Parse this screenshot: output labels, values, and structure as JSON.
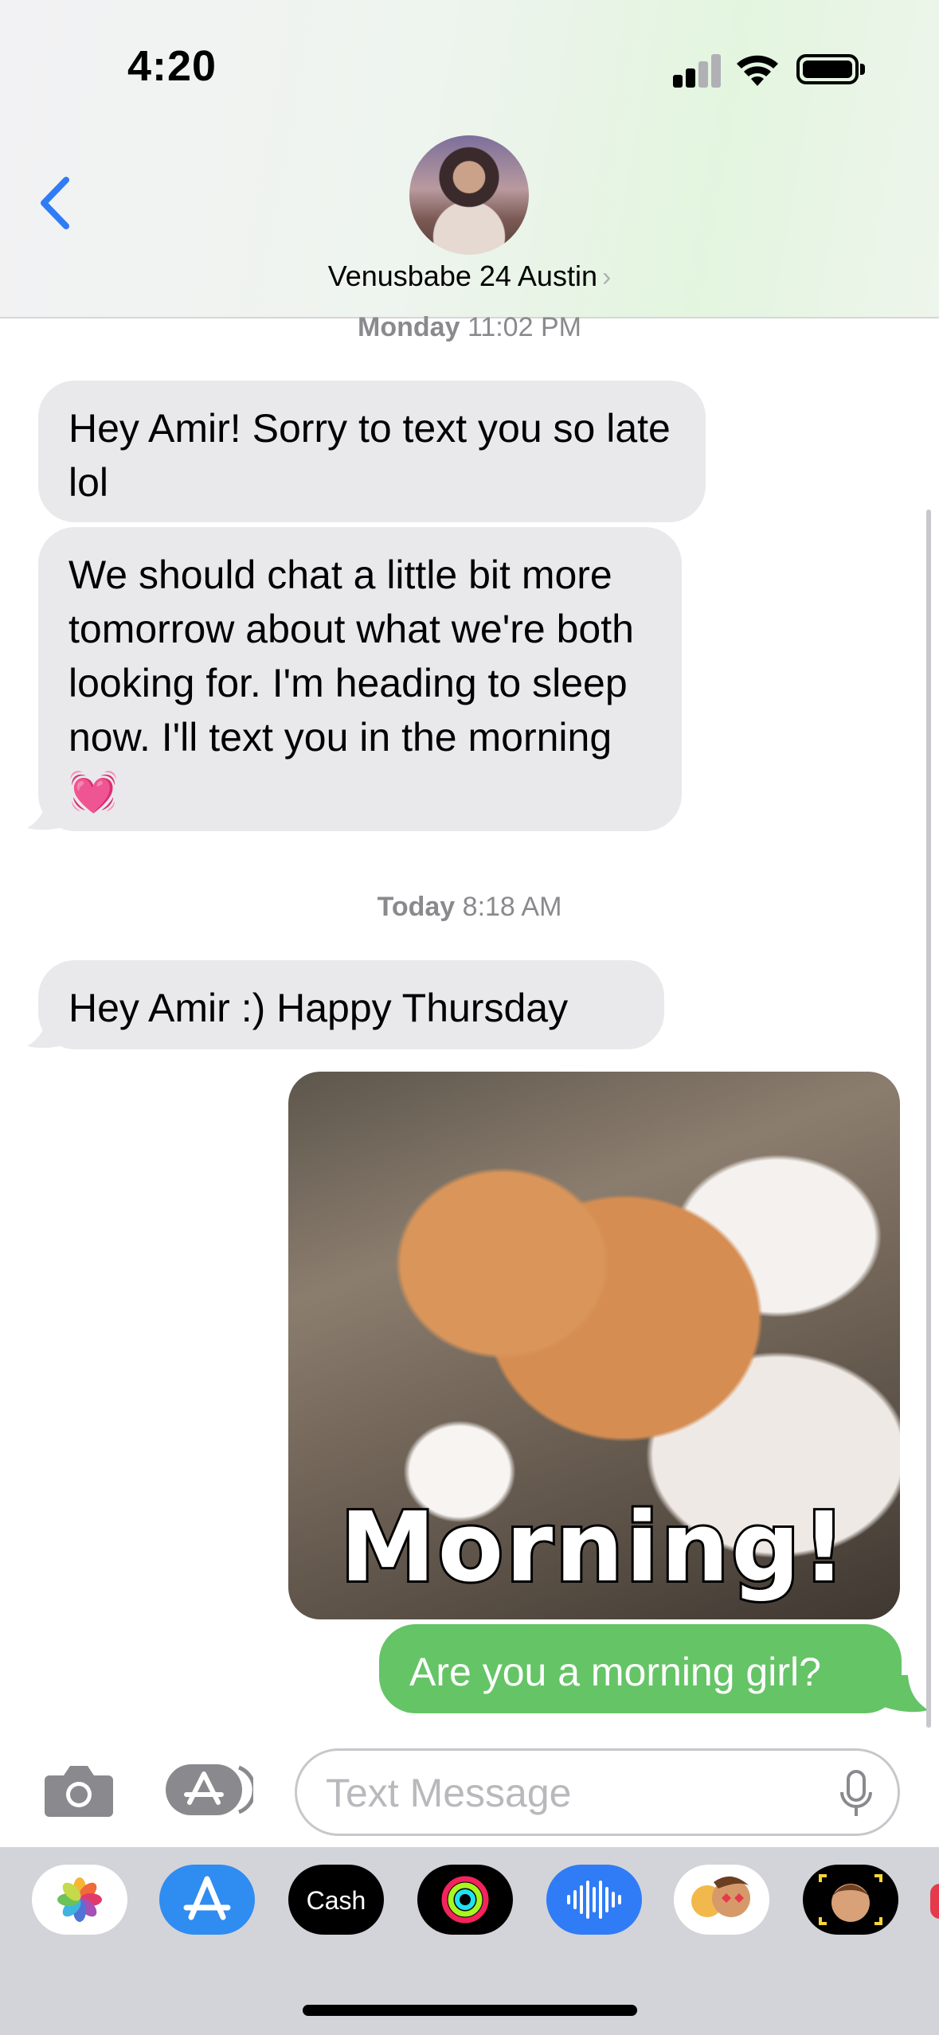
{
  "status_bar": {
    "time": "4:20"
  },
  "header": {
    "contact_name": "Venusbabe 24 Austin",
    "chevron": "›"
  },
  "messages": [
    {
      "type": "timestamp",
      "day": "Monday",
      "time": "11:02 PM"
    },
    {
      "type": "incoming",
      "text": "Hey Amir! Sorry to text you so late lol"
    },
    {
      "type": "incoming",
      "text": "We should chat a little bit more tomorrow about what we're both looking for. I'm heading to sleep now. I'll text you in the morning 💓"
    },
    {
      "type": "timestamp",
      "day": "Today",
      "time": "8:18 AM"
    },
    {
      "type": "incoming",
      "text": "Hey Amir :) Happy Thursday"
    },
    {
      "type": "outgoing-gif",
      "caption": "Morning!"
    },
    {
      "type": "outgoing",
      "text": "Are you a morning girl?"
    }
  ],
  "compose": {
    "placeholder": "Text Message"
  },
  "app_drawer": {
    "apps": [
      "photos-icon",
      "app-store-icon",
      "cash-icon",
      "fitness-icon",
      "audio-icon",
      "memoji-stickers-icon",
      "memoji-icon"
    ],
    "cash_label": "Cash"
  },
  "colors": {
    "outgoing": "#65c466",
    "incoming": "#e9e9eb",
    "accent": "#2f7cf6"
  }
}
